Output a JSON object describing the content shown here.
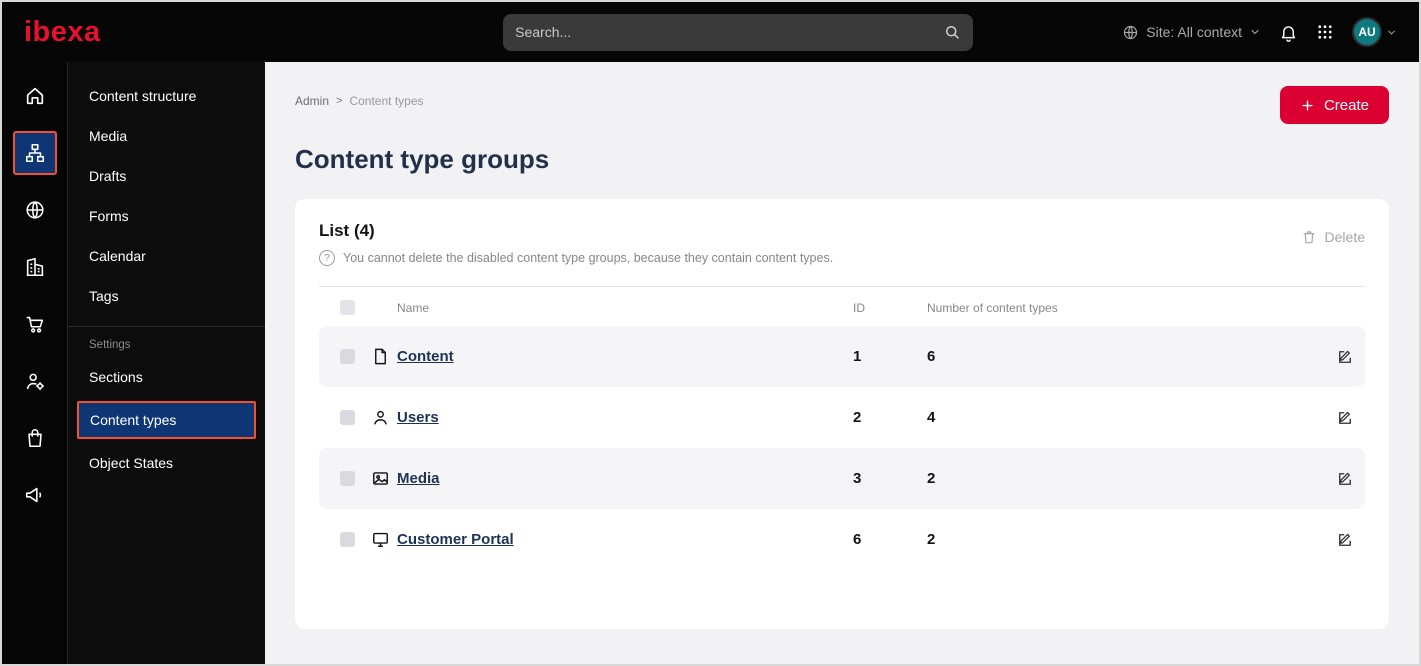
{
  "topbar": {
    "logo": "ibexa",
    "search_placeholder": "Search...",
    "site_label": "Site: All context",
    "avatar_initials": "AU"
  },
  "rail": {
    "items": [
      {
        "icon": "home-icon"
      },
      {
        "icon": "content-structure-icon",
        "active": true
      },
      {
        "icon": "site-globe-icon"
      },
      {
        "icon": "company-building-icon"
      },
      {
        "icon": "commerce-cart-icon"
      },
      {
        "icon": "admin-user-settings-icon"
      },
      {
        "icon": "product-catalog-icon"
      },
      {
        "icon": "marketing-megaphone-icon"
      }
    ]
  },
  "menu": {
    "items": [
      "Content structure",
      "Media",
      "Drafts",
      "Forms",
      "Calendar",
      "Tags"
    ],
    "section_label": "Settings",
    "settings_items": [
      "Sections",
      "Content types",
      "Object States"
    ],
    "active_item": "Content types"
  },
  "page": {
    "breadcrumb": {
      "root": "Admin",
      "separator": ">",
      "current": "Content types"
    },
    "create_label": "Create",
    "title": "Content type groups"
  },
  "list": {
    "title": "List (4)",
    "info": "You cannot delete the disabled content type groups, because they contain content types.",
    "delete_label": "Delete",
    "columns": {
      "name": "Name",
      "id": "ID",
      "count": "Number of content types"
    },
    "rows": [
      {
        "icon": "content-file-icon",
        "name": "Content",
        "id": "1",
        "count": "6"
      },
      {
        "icon": "users-person-icon",
        "name": "Users",
        "id": "2",
        "count": "4"
      },
      {
        "icon": "media-image-icon",
        "name": "Media",
        "id": "3",
        "count": "2"
      },
      {
        "icon": "customer-portal-icon",
        "name": "Customer Portal",
        "id": "6",
        "count": "2"
      }
    ]
  },
  "colors": {
    "accent_red": "#dc0032",
    "active_blue": "#0e3674",
    "highlight_orange": "#f4502a",
    "avatar_teal": "#0e7a80"
  }
}
